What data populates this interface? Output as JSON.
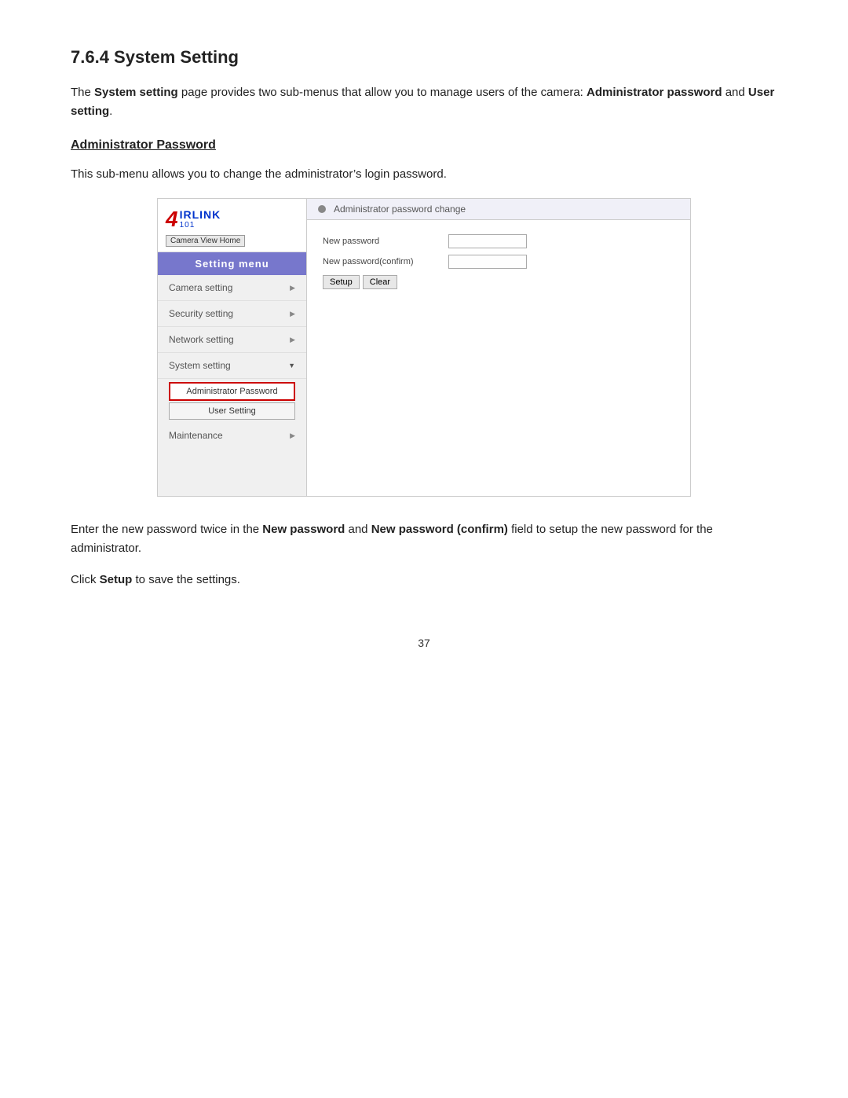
{
  "page": {
    "section_title": "7.6.4 System Setting",
    "intro_text": "The System setting page provides two sub-menus that allow you to manage users of the camera: Administrator password and User setting.",
    "intro_bold1": "System setting",
    "intro_bold2": "Administrator password",
    "intro_bold3": "User setting",
    "sub_title": "Administrator Password",
    "sub_desc": "This sub-menu allows you to change the administrator’s login password.",
    "footer_text1": "Enter the new password twice in the New password and New password (confirm) field to setup the new password for the administrator.",
    "footer_bold1": "New password",
    "footer_bold2": "New password (confirm)",
    "footer_text2": "Click Setup to save the settings.",
    "footer_bold3": "Setup",
    "page_number": "37"
  },
  "sidebar": {
    "logo_4": "4",
    "logo_top": "IRLINK",
    "logo_bottom": "101",
    "camera_view_btn": "Camera View Home",
    "setting_menu_header": "Setting menu",
    "menu_items": [
      {
        "label": "Camera setting",
        "arrow": "▶",
        "type": "expand"
      },
      {
        "label": "Security setting",
        "arrow": "▶",
        "type": "expand"
      },
      {
        "label": "Network setting",
        "arrow": "▶",
        "type": "expand"
      },
      {
        "label": "System setting",
        "arrow": "▼",
        "type": "active"
      }
    ],
    "sub_menu": [
      {
        "label": "Administrator Password",
        "active": true
      },
      {
        "label": "User Setting",
        "active": false
      }
    ],
    "maintenance_label": "Maintenance",
    "maintenance_arrow": "▶"
  },
  "content_panel": {
    "header_icon": "●",
    "header_text": "Administrator password change",
    "fields": [
      {
        "label": "New password",
        "id": "new-password"
      },
      {
        "label": "New password(confirm)",
        "id": "confirm-password"
      }
    ],
    "btn_setup": "Setup",
    "btn_clear": "Clear"
  }
}
